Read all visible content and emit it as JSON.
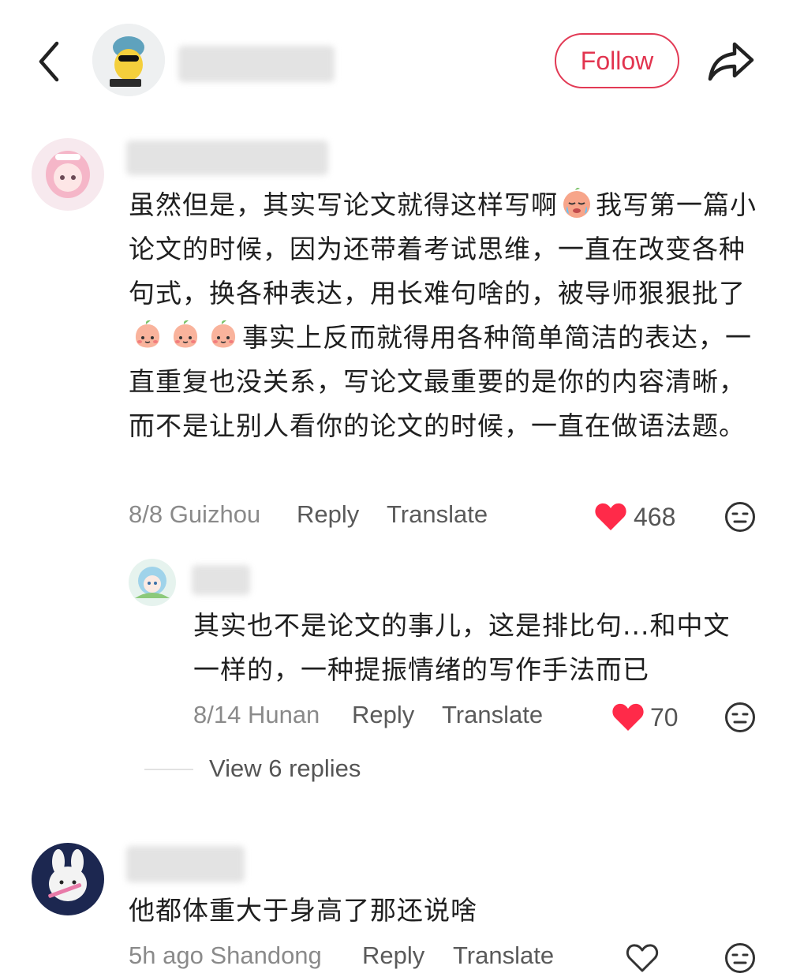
{
  "header": {
    "follow_label": "Follow",
    "accent_color": "#e2344f"
  },
  "comments": [
    {
      "text_parts": [
        "虽然但是，其实写论文就得这样写啊",
        "我写第一篇小论文的时候，因为还带着考试思维，一直在改变各种句式，换各种表达，用长难句啥的，被导师狠狠批了",
        "事实上反而就得用各种简单简洁的表达，一直重复也没关系，写论文最重要的是你的内容清晰，而不是让别人看你的论文的时候，一直在做语法题。"
      ],
      "date_location": "8/8 Guizhou",
      "reply_label": "Reply",
      "translate_label": "Translate",
      "likes": "468",
      "liked": true
    },
    {
      "text": "其实也不是论文的事儿，这是排比句...和中文一样的，一种提振情绪的写作手法而已",
      "date_location": "8/14 Hunan",
      "reply_label": "Reply",
      "translate_label": "Translate",
      "likes": "70",
      "liked": true
    },
    {
      "text": "他都体重大于身高了那还说啥",
      "date_location": "5h ago Shandong",
      "reply_label": "Reply",
      "translate_label": "Translate",
      "liked": false
    }
  ],
  "view_replies_label": "View 6 replies",
  "icons": {
    "back": "chevron-left-icon",
    "share": "share-arrow-icon",
    "like": "heart-icon",
    "dislike": "meh-face-icon",
    "emoji_cry": "crying-emoji-icon",
    "emoji_peach": "peach-face-emoji-icon"
  }
}
